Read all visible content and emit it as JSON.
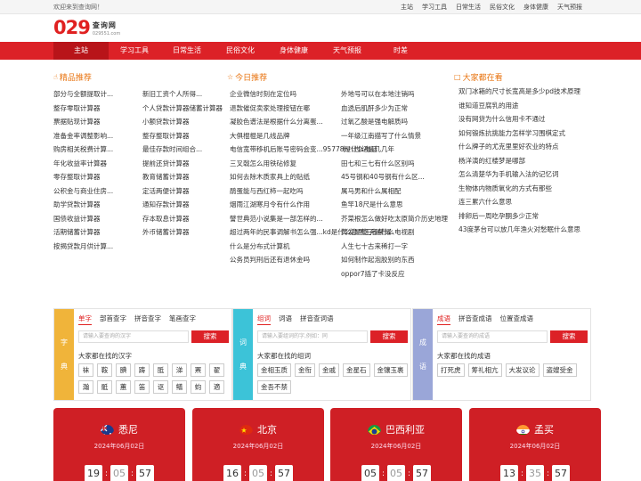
{
  "topbar": {
    "welcome": "欢迎来到查询网！",
    "links": [
      "主站",
      "学习工具",
      "日常生活",
      "民俗文化",
      "身体健康",
      "天气预报"
    ]
  },
  "logo": {
    "number": "029",
    "name": "查询网",
    "domain": "029551.com"
  },
  "nav": [
    "主站",
    "学习工具",
    "日常生活",
    "民俗文化",
    "身体健康",
    "天气预报",
    "时差"
  ],
  "sections": {
    "picks": {
      "title": "精品推荐",
      "icon": "thumb-icon"
    },
    "today": {
      "title": "今日推荐",
      "icon": "star-icon"
    },
    "looking": {
      "title": "大家都在看",
      "icon": "chat-icon"
    }
  },
  "picks_left": [
    "部分与全额提取计...",
    "整存零取计算器",
    "票据贴现计算器",
    "准备金率调整影响...",
    "购房相关税费计算...",
    "年化收益率计算器",
    "零存整取计算器",
    "公积金与商业住房...",
    "助学贷款计算器",
    "国债收益计算器",
    "活期储蓄计算器",
    "按揭贷款月供计算..."
  ],
  "picks_right": [
    "新旧工资个人所得...",
    "个人贷款计算器",
    "储蓄计算器",
    "小额贷款计算器",
    "整存整取计算器",
    "最佳存款时间组合...",
    "提前还贷计算器",
    "教育储蓄计算器",
    "定活两便计算器",
    "通知存款计算器",
    "存本取息计算器",
    "外币储蓄计算器"
  ],
  "today_left": [
    "企业微信时刻在定位吗",
    "退款催促卖家处理按钮在哪",
    "凝胶色谱法是根据什么分离蛋...",
    "大俱棍棍是几线品牌",
    "电信宽带移机后账号密码会变...",
    "95778是什么电话",
    "三叉戟怎么用铁砧修复",
    "如何去除木质家具上的贴纸",
    "鹃蛋能与西红柿一起吃吗",
    "烟雨江湖寒月令有什么作用",
    "譬世典范小说集是一部怎样的...",
    "超过两年的民事调解书怎么强...",
    "kd是什么意思王者荣耀",
    "什么是分布式计算机",
    "公务员判刑后还有退休金吗"
  ],
  "today_right": [
    "外地号可以在本地注销吗",
    "血透后肌酐多少为正常",
    "过氧乙酸是强电解质吗",
    "一年级江南描写了什么情景",
    "十八世纪是几几年",
    "田七和三七有什么区别吗",
    "45号钢和40号钢有什么区...",
    "属马男和什么属相配",
    "鱼竿18尺是什么意思",
    "芥菜根怎么做好吃",
    "太原简介历史地理",
    "黄发是傻子是什么电视剧",
    "人生七十古来稀打一字",
    "如何制作起泡胶别的东西",
    "oppor7插了卡没反应"
  ],
  "looking": [
    "双门冰箱的尺寸长宽高是多少",
    "pd技术原理",
    "谁知道豆腐乳的用途",
    "没有网贷为什么信用卡不通过",
    "如何锻炼抗挑能力",
    "怎样学习围棋定式",
    "什么牌子的尤克里里好",
    "农业的特点",
    "杨洋演的红楼梦是哪部",
    "怎么清楚华为手机输入法的记忆词",
    "生物体内物质氧化的方式有那些",
    "连三累六什么意思",
    "排卵后一周吃孕酮多少正常",
    "43度茅台可以放几年",
    "渔火对愁眠什么意思"
  ],
  "panels": [
    {
      "side": [
        "字",
        "典"
      ],
      "tabs": [
        "单字",
        "部首查字",
        "拼音查字",
        "笔画查字"
      ],
      "placeholder": "请输入要查询的汉字",
      "button": "搜索",
      "hot_label": "大家都在找的汉字",
      "chips": [
        "袜",
        "鞍",
        "腆",
        "踌",
        "胝",
        "涕",
        "罴",
        "翟",
        "瀚",
        "骶",
        "蕙",
        "笛",
        "讴",
        "鳝",
        "蚐",
        "適"
      ]
    },
    {
      "side": [
        "词",
        "典"
      ],
      "tabs": [
        "组词",
        "词语",
        "拼音查词语"
      ],
      "placeholder": "请输入要组词的字,例如：同",
      "button": "搜索",
      "hot_label": "大家都在找的组词",
      "chips": [
        "金相玉质",
        "金衔",
        "金戚",
        "金星石",
        "金镶玉裹",
        "金吾不禁"
      ]
    },
    {
      "side": [
        "成",
        "语"
      ],
      "tabs": [
        "成语",
        "拼音查成语",
        "位置查成语"
      ],
      "placeholder": "请输入要查询的成语",
      "button": "搜索",
      "hot_label": "大家都在找的成语",
      "chips": [
        "打死虎",
        "筹礼相亢",
        "大发议论",
        "盗嫂受金"
      ]
    }
  ],
  "panel_colors": [
    "#f0b43a",
    "#3cc3d8",
    "#9aa6d8"
  ],
  "clocks": [
    {
      "city": "悉尼",
      "date": "2024年06月02日",
      "h": "19",
      "m": "05",
      "s": "57",
      "flag": "australia-flag-icon"
    },
    {
      "city": "北京",
      "date": "2024年06月02日",
      "h": "16",
      "m": "05",
      "s": "57",
      "flag": "china-flag-icon"
    },
    {
      "city": "巴西利亚",
      "date": "2024年06月02日",
      "h": "05",
      "m": "05",
      "s": "57",
      "flag": "brazil-flag-icon"
    },
    {
      "city": "孟买",
      "date": "2024年06月02日",
      "h": "13",
      "m": "35",
      "s": "57",
      "flag": "india-flag-icon"
    }
  ]
}
